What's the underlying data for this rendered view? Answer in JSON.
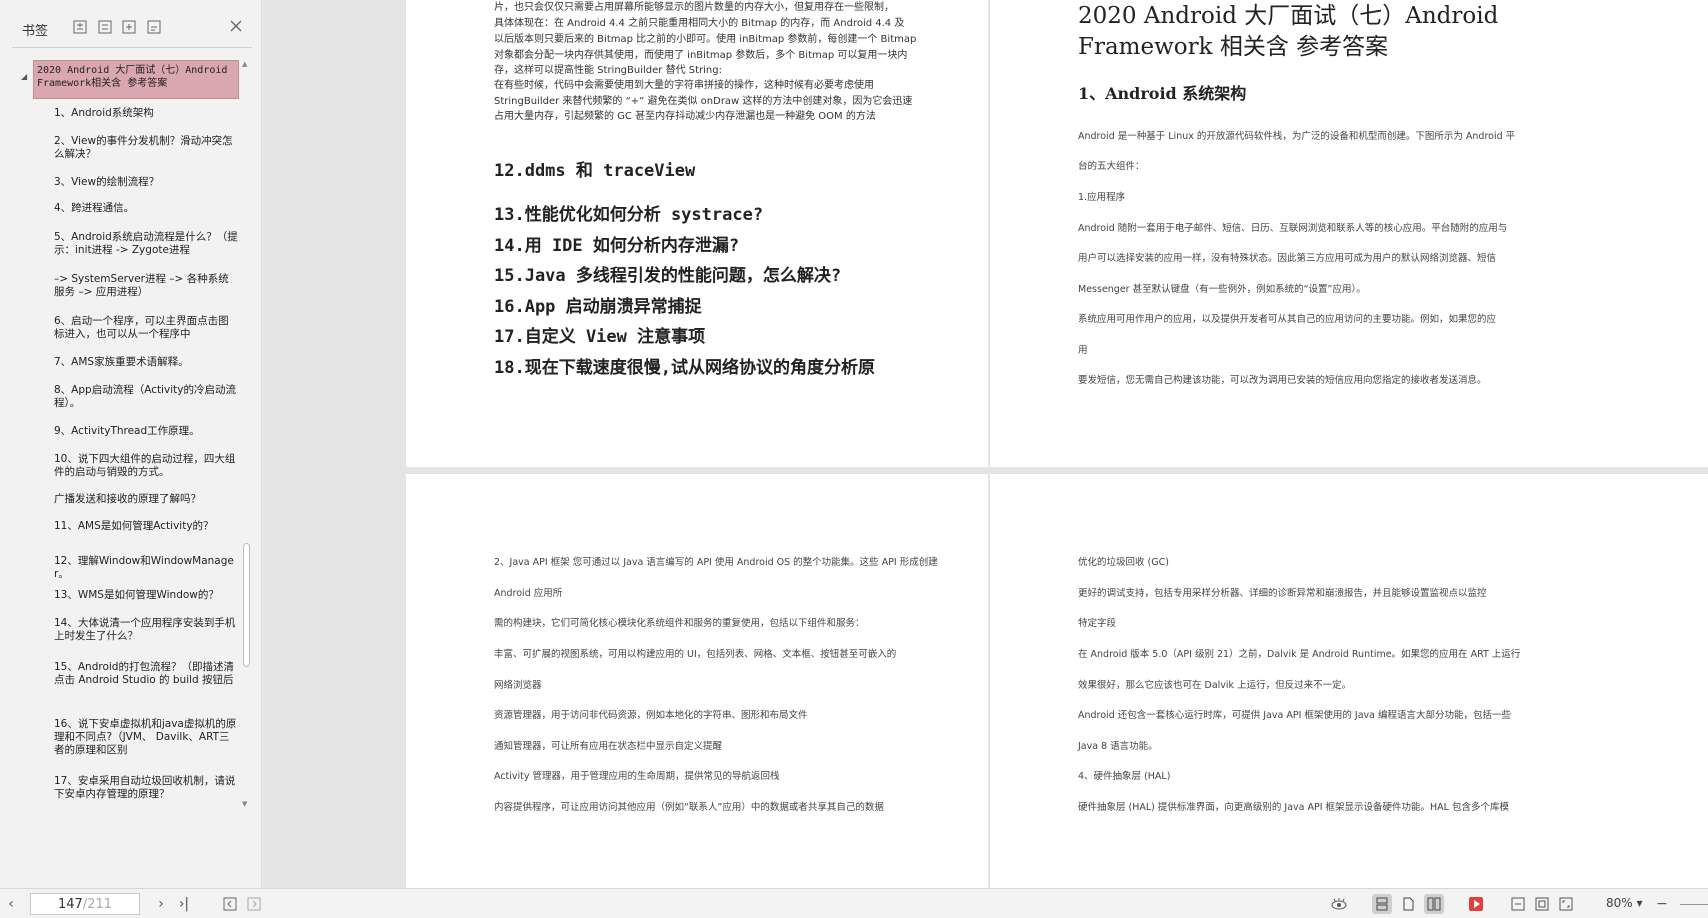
{
  "sidebar": {
    "title": "书签",
    "root": "2020 Android 大厂面试（七）Android Framework相关含 参考答案",
    "items": [
      "1、Android系统架构",
      "2、View的事件分发机制？滑动冲突怎么解决？",
      "3、View的绘制流程？",
      "4、跨进程通信。",
      "5、Android系统启动流程是什么？（提示：init进程 -> Zygote进程",
      "–> SystemServer进程 –> 各种系统服务 –> 应用进程）",
      "6、启动一个程序，可以主界面点击图标进入，也可以从一个程序中",
      "7、AMS家族重要术语解释。",
      "8、App启动流程（Activity的冷启动流程）。",
      "9、ActivityThread工作原理。",
      "10、说下四大组件的启动过程，四大组件的启动与销毁的方式。",
      "广播发送和接收的原理了解吗？",
      "11、AMS是如何管理Activity的？",
      "12、理解Window和WindowManager。",
      "13、WMS是如何管理Window的？",
      "14、大体说清一个应用程序安装到手机上时发生了什么？",
      "15、Android的打包流程？（即描述清点击 Android Studio 的 build 按钮后",
      "16、说下安卓虚拟机和java虚拟机的原理和不同点?（JVM、 Davilk、ART三者的原理和区别",
      "17、安卓采用自动垃圾回收机制，请说下安卓内存管理的原理？"
    ]
  },
  "page1": {
    "lines": [
      "片，也只会仅仅只需要占用屏幕所能够显示的图片数量的内存大小，但复用存在一些限制，",
      "具体体现在：在 Android 4.4 之前只能重用相同大小的 Bitmap 的内存，而 Android 4.4 及",
      "以后版本则只要后来的 Bitmap 比之前的小即可。使用 inBitmap 参数前，每创建一个 Bitmap",
      "对象都会分配一块内存供其使用，而使用了 inBitmap 参数后，多个 Bitmap 可以复用一块内",
      "存，这样可以提高性能 StringBuilder 替代 String:",
      "在有些时候，代码中会需要使用到大量的字符串拼接的操作，这种时候有必要考虑使用",
      "StringBuilder 来替代频繁的 “+” 避免在类似 onDraw 这样的方法中创建对象，因为它会迅速",
      "占用大量内存，引起频繁的 GC 甚至内存抖动减少内存泄漏也是一种避免 OOM 的方法"
    ],
    "headings": [
      "12.ddms 和 traceView",
      "13.性能优化如何分析 systrace?",
      "14.用 IDE 如何分析内存泄漏?",
      "15.Java 多线程引发的性能问题，怎么解决?",
      "16.App 启动崩溃异常捕捉",
      "17.自定义 View 注意事项",
      "18.现在下载速度很慢,试从网络协议的角度分析原"
    ]
  },
  "page2": {
    "title_line1": "2020 Android 大厂面试（七）Android",
    "title_line2": "Framework 相关含 参考答案",
    "subtitle": "1、Android 系统架构",
    "lines": [
      "Android 是一种基于 Linux 的开放源代码软件栈，为广泛的设备和机型而创建。下图所示为 Android 平",
      "台的五大组件：",
      "1.应用程序",
      "Android 随附一套用于电子邮件、短信、日历、互联网浏览和联系人等的核心应用。平台随附的应用与",
      "用户可以选择安装的应用一样，没有特殊状态。因此第三方应用可成为用户的默认网络浏览器、短信",
      "Messenger 甚至默认键盘（有一些例外，例如系统的“设置”应用）。",
      "系统应用可用作用户的应用，以及提供开发者可从其自己的应用访问的主要功能。例如，如果您的应",
      "用",
      "要发短信，您无需自己构建该功能，可以改为调用已安装的短信应用向您指定的接收者发送消息。"
    ]
  },
  "page3": {
    "lines": [
      "2、Java API 框架 您可通过以 Java 语言编写的 API 使用 Android OS 的整个功能集。这些 API 形成创建",
      "Android 应用所",
      "需的构建块，它们可简化核心模块化系统组件和服务的重复使用，包括以下组件和服务：",
      "丰富、可扩展的视图系统，可用以构建应用的 UI，包括列表、网格、文本框、按钮甚至可嵌入的",
      "网络浏览器",
      "资源管理器，用于访问非代码资源，例如本地化的字符串、图形和布局文件",
      "通知管理器，可让所有应用在状态栏中显示自定义提醒",
      "Activity 管理器，用于管理应用的生命周期，提供常见的导航返回栈",
      "内容提供程序，可让应用访问其他应用（例如“联系人”应用）中的数据或者共享其自己的数据"
    ]
  },
  "page4": {
    "lines": [
      "优化的垃圾回收 (GC)",
      "更好的调试支持，包括专用采样分析器、详细的诊断异常和崩溃报告，并且能够设置监视点以监控",
      "特定字段",
      "在 Android 版本 5.0（API 级别 21）之前，Dalvik 是 Android Runtime。如果您的应用在 ART 上运行",
      "效果很好，那么它应该也可在 Dalvik 上运行，但反过来不一定。",
      "Android 还包含一套核心运行时库，可提供 Java API 框架使用的 Java 编程语言大部分功能，包括一些",
      "Java 8 语言功能。",
      "4、硬件抽象层 (HAL)",
      "硬件抽象层 (HAL) 提供标准界面，向更高级别的 Java API 框架显示设备硬件功能。HAL 包含多个库模"
    ]
  },
  "statusbar": {
    "current_page": "147",
    "total_pages": "/211",
    "zoom": "80%"
  },
  "colors": {
    "selected_bookmark": "#d9a7ad",
    "play_red": "#e2403f"
  }
}
